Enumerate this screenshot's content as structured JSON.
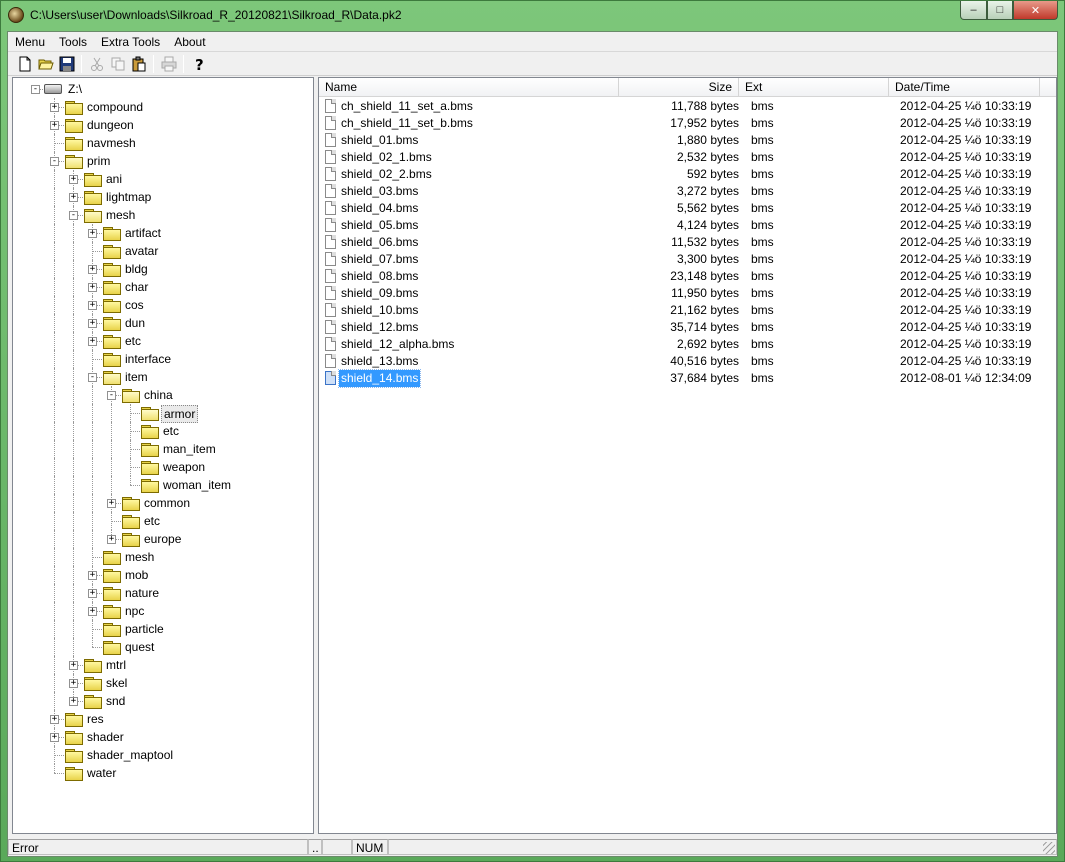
{
  "window": {
    "title": "C:\\Users\\user\\Downloads\\Silkroad_R_20120821\\Silkroad_R\\Data.pk2",
    "minimize_glyph": "–",
    "maximize_glyph": "□",
    "close_glyph": "✕"
  },
  "menu": [
    "Menu",
    "Tools",
    "Extra Tools",
    "About"
  ],
  "toolbar": [
    "new-file-icon",
    "open-folder-icon",
    "save-icon",
    "cut-icon",
    "copy-icon",
    "paste-icon",
    "print-icon",
    "help-icon"
  ],
  "tree": [
    {
      "label": "Z:\\",
      "depth": 0,
      "type": "drive",
      "exp": "-"
    },
    {
      "label": "compound",
      "depth": 1,
      "exp": "+"
    },
    {
      "label": "dungeon",
      "depth": 1,
      "exp": "+"
    },
    {
      "label": "navmesh",
      "depth": 1,
      "exp": ""
    },
    {
      "label": "prim",
      "depth": 1,
      "exp": "-"
    },
    {
      "label": "ani",
      "depth": 2,
      "exp": "+"
    },
    {
      "label": "lightmap",
      "depth": 2,
      "exp": "+"
    },
    {
      "label": "mesh",
      "depth": 2,
      "exp": "-"
    },
    {
      "label": "artifact",
      "depth": 3,
      "exp": "+"
    },
    {
      "label": "avatar",
      "depth": 3,
      "exp": ""
    },
    {
      "label": "bldg",
      "depth": 3,
      "exp": "+"
    },
    {
      "label": "char",
      "depth": 3,
      "exp": "+"
    },
    {
      "label": "cos",
      "depth": 3,
      "exp": "+"
    },
    {
      "label": "dun",
      "depth": 3,
      "exp": "+"
    },
    {
      "label": "etc",
      "depth": 3,
      "exp": "+"
    },
    {
      "label": "interface",
      "depth": 3,
      "exp": ""
    },
    {
      "label": "item",
      "depth": 3,
      "exp": "-"
    },
    {
      "label": "china",
      "depth": 4,
      "exp": "-"
    },
    {
      "label": "armor",
      "depth": 5,
      "exp": "",
      "selected": true
    },
    {
      "label": "etc",
      "depth": 5,
      "exp": ""
    },
    {
      "label": "man_item",
      "depth": 5,
      "exp": ""
    },
    {
      "label": "weapon",
      "depth": 5,
      "exp": ""
    },
    {
      "label": "woman_item",
      "depth": 5,
      "exp": ""
    },
    {
      "label": "common",
      "depth": 4,
      "exp": "+"
    },
    {
      "label": "etc",
      "depth": 4,
      "exp": ""
    },
    {
      "label": "europe",
      "depth": 4,
      "exp": "+"
    },
    {
      "label": "mesh",
      "depth": 3,
      "exp": ""
    },
    {
      "label": "mob",
      "depth": 3,
      "exp": "+"
    },
    {
      "label": "nature",
      "depth": 3,
      "exp": "+"
    },
    {
      "label": "npc",
      "depth": 3,
      "exp": "+"
    },
    {
      "label": "particle",
      "depth": 3,
      "exp": ""
    },
    {
      "label": "quest",
      "depth": 3,
      "exp": ""
    },
    {
      "label": "mtrl",
      "depth": 2,
      "exp": "+"
    },
    {
      "label": "skel",
      "depth": 2,
      "exp": "+"
    },
    {
      "label": "snd",
      "depth": 2,
      "exp": "+"
    },
    {
      "label": "res",
      "depth": 1,
      "exp": "+"
    },
    {
      "label": "shader",
      "depth": 1,
      "exp": "+"
    },
    {
      "label": "shader_maptool",
      "depth": 1,
      "exp": ""
    },
    {
      "label": "water",
      "depth": 1,
      "exp": ""
    }
  ],
  "list": {
    "columns": [
      "Name",
      "Size",
      "Ext",
      "Date/Time"
    ],
    "rows": [
      {
        "name": "ch_shield_11_set_a.bms",
        "size": "11,788 bytes",
        "ext": "bms",
        "date": "2012-04-25 ¼ö 10:33:19"
      },
      {
        "name": "ch_shield_11_set_b.bms",
        "size": "17,952 bytes",
        "ext": "bms",
        "date": "2012-04-25 ¼ö 10:33:19"
      },
      {
        "name": "shield_01.bms",
        "size": "1,880 bytes",
        "ext": "bms",
        "date": "2012-04-25 ¼ö 10:33:19"
      },
      {
        "name": "shield_02_1.bms",
        "size": "2,532 bytes",
        "ext": "bms",
        "date": "2012-04-25 ¼ö 10:33:19"
      },
      {
        "name": "shield_02_2.bms",
        "size": "592 bytes",
        "ext": "bms",
        "date": "2012-04-25 ¼ö 10:33:19"
      },
      {
        "name": "shield_03.bms",
        "size": "3,272 bytes",
        "ext": "bms",
        "date": "2012-04-25 ¼ö 10:33:19"
      },
      {
        "name": "shield_04.bms",
        "size": "5,562 bytes",
        "ext": "bms",
        "date": "2012-04-25 ¼ö 10:33:19"
      },
      {
        "name": "shield_05.bms",
        "size": "4,124 bytes",
        "ext": "bms",
        "date": "2012-04-25 ¼ö 10:33:19"
      },
      {
        "name": "shield_06.bms",
        "size": "11,532 bytes",
        "ext": "bms",
        "date": "2012-04-25 ¼ö 10:33:19"
      },
      {
        "name": "shield_07.bms",
        "size": "3,300 bytes",
        "ext": "bms",
        "date": "2012-04-25 ¼ö 10:33:19"
      },
      {
        "name": "shield_08.bms",
        "size": "23,148 bytes",
        "ext": "bms",
        "date": "2012-04-25 ¼ö 10:33:19"
      },
      {
        "name": "shield_09.bms",
        "size": "11,950 bytes",
        "ext": "bms",
        "date": "2012-04-25 ¼ö 10:33:19"
      },
      {
        "name": "shield_10.bms",
        "size": "21,162 bytes",
        "ext": "bms",
        "date": "2012-04-25 ¼ö 10:33:19"
      },
      {
        "name": "shield_12.bms",
        "size": "35,714 bytes",
        "ext": "bms",
        "date": "2012-04-25 ¼ö 10:33:19"
      },
      {
        "name": "shield_12_alpha.bms",
        "size": "2,692 bytes",
        "ext": "bms",
        "date": "2012-04-25 ¼ö 10:33:19"
      },
      {
        "name": "shield_13.bms",
        "size": "40,516 bytes",
        "ext": "bms",
        "date": "2012-04-25 ¼ö 10:33:19"
      },
      {
        "name": "shield_14.bms",
        "size": "37,684 bytes",
        "ext": "bms",
        "date": "2012-08-01 ¼ö 12:34:09",
        "selected": true
      }
    ]
  },
  "status": {
    "message": "Error",
    "panel2": "..",
    "panel3": "",
    "num": "NUM",
    "panel5": ""
  }
}
